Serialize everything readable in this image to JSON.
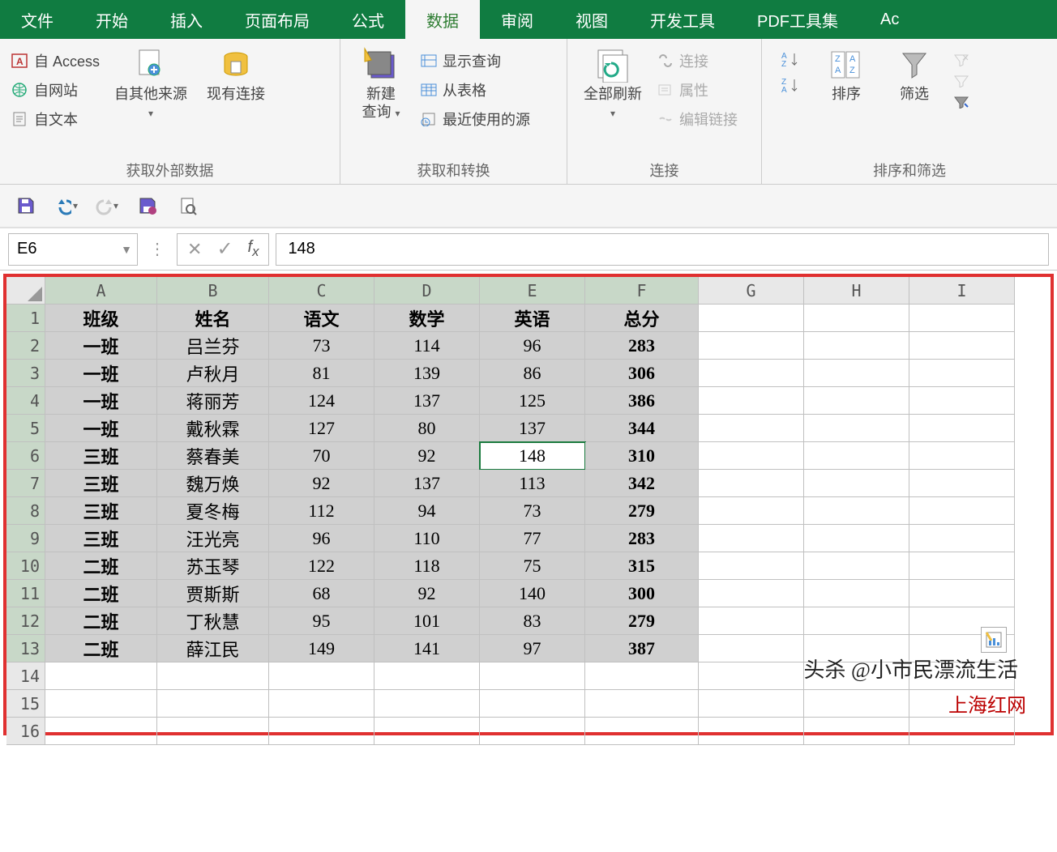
{
  "tabs": [
    "文件",
    "开始",
    "插入",
    "页面布局",
    "公式",
    "数据",
    "审阅",
    "视图",
    "开发工具",
    "PDF工具集",
    "Ac"
  ],
  "active_tab_index": 5,
  "ribbon": {
    "group1": {
      "label": "获取外部数据",
      "access": "自 Access",
      "web": "自网站",
      "text": "自文本",
      "other": "自其他来源",
      "existing": "现有连接"
    },
    "group2": {
      "label": "获取和转换",
      "newquery": "新建\n查询",
      "showquery": "显示查询",
      "fromtable": "从表格",
      "recent": "最近使用的源"
    },
    "group3": {
      "label": "连接",
      "refresh": "全部刷新",
      "conn": "连接",
      "prop": "属性",
      "edit": "编辑链接"
    },
    "group4": {
      "label": "排序和筛选",
      "sort": "排序",
      "filter": "筛选"
    }
  },
  "namebox": "E6",
  "formula": "148",
  "columns": [
    "A",
    "B",
    "C",
    "D",
    "E",
    "F",
    "G",
    "H",
    "I"
  ],
  "headers": [
    "班级",
    "姓名",
    "语文",
    "数学",
    "英语",
    "总分"
  ],
  "rows": [
    [
      "一班",
      "吕兰芬",
      "73",
      "114",
      "96",
      "283"
    ],
    [
      "一班",
      "卢秋月",
      "81",
      "139",
      "86",
      "306"
    ],
    [
      "一班",
      "蒋丽芳",
      "124",
      "137",
      "125",
      "386"
    ],
    [
      "一班",
      "戴秋霖",
      "127",
      "80",
      "137",
      "344"
    ],
    [
      "三班",
      "蔡春美",
      "70",
      "92",
      "148",
      "310"
    ],
    [
      "三班",
      "魏万焕",
      "92",
      "137",
      "113",
      "342"
    ],
    [
      "三班",
      "夏冬梅",
      "112",
      "94",
      "73",
      "279"
    ],
    [
      "三班",
      "汪光亮",
      "96",
      "110",
      "77",
      "283"
    ],
    [
      "二班",
      "苏玉琴",
      "122",
      "118",
      "75",
      "315"
    ],
    [
      "二班",
      "贾斯斯",
      "68",
      "92",
      "140",
      "300"
    ],
    [
      "二班",
      "丁秋慧",
      "95",
      "101",
      "83",
      "279"
    ],
    [
      "二班",
      "薛江民",
      "149",
      "141",
      "97",
      "387"
    ]
  ],
  "empty_rows": [
    14,
    15,
    16
  ],
  "active_cell": {
    "row": 6,
    "col": 5
  },
  "selection": {
    "r1": 1,
    "c1": 1,
    "r2": 13,
    "c2": 6
  },
  "watermark1": "头杀 @小市民漂流生活",
  "watermark2": "上海红网"
}
